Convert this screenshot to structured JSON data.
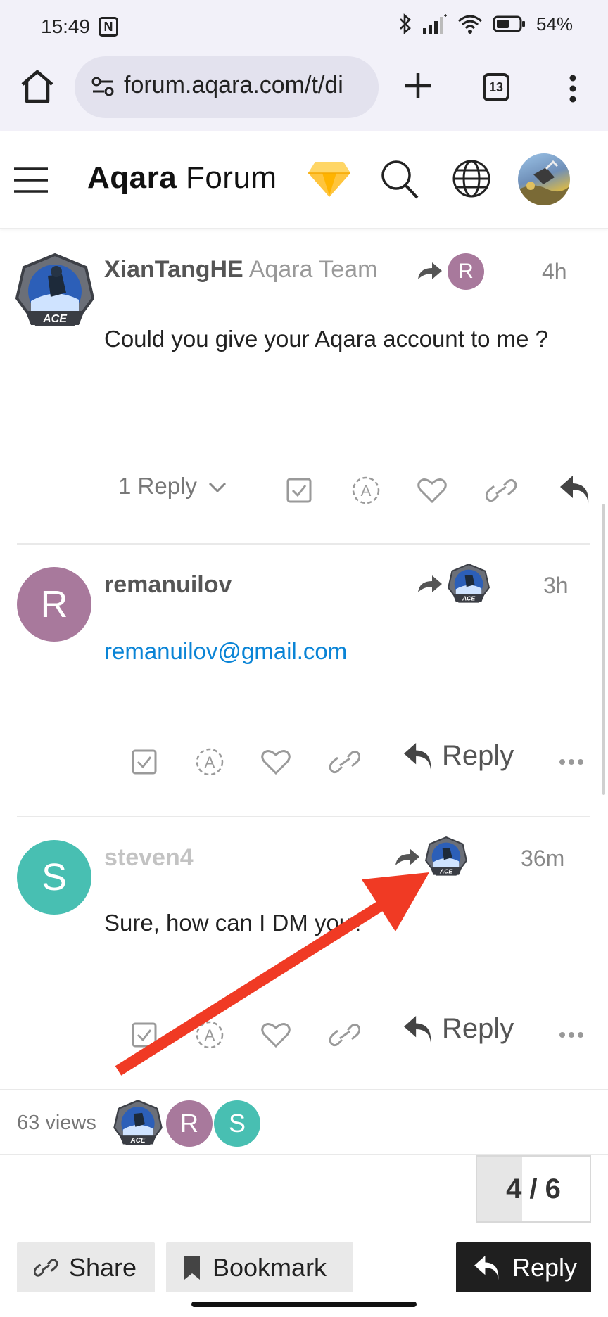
{
  "status_bar": {
    "time": "15:49",
    "nfc": "N",
    "battery_pct": "54%"
  },
  "browser": {
    "url": "forum.aqara.com/t/di",
    "tab_count": "13",
    "icons": [
      "home-icon",
      "site-settings-icon",
      "new-tab-icon",
      "tab-switcher-icon",
      "menu-kebab-icon"
    ]
  },
  "forum_header": {
    "brand": "Aqara",
    "brand_suffix": "Forum",
    "icons": [
      "hamburger-menu-icon",
      "diamond-badge-icon",
      "search-icon",
      "globe-icon",
      "user-avatar"
    ]
  },
  "posts": [
    {
      "author": "XianTangHE",
      "title": "Aqara Team",
      "avatar_badge": "ACE",
      "reply_to_letter": "R",
      "time": "4h",
      "body": "Could you give your Aqara account to me ?",
      "replies_label": "1 Reply"
    },
    {
      "author": "remanuilov",
      "avatar_letter": "R",
      "reply_to_badge": "ACE",
      "time": "3h",
      "body": "remanuilov@gmail.com",
      "reply_label": "Reply"
    },
    {
      "author": "steven4",
      "avatar_letter": "S",
      "reply_to_badge": "ACE",
      "time": "36m",
      "body": "Sure, how can I DM you?",
      "reply_label": "Reply"
    }
  ],
  "footer": {
    "views": "63 views",
    "participants": [
      "ACE",
      "R",
      "S"
    ],
    "progress_label": "4 / 6",
    "progress_current": 4,
    "progress_total": 6,
    "share_label": "Share",
    "bookmark_label": "Bookmark",
    "reply_label": "Reply"
  },
  "colors": {
    "avatar_r": "#a8799c",
    "avatar_s": "#48bfb2",
    "link": "#0a84d6",
    "annotation_arrow": "#f03a24",
    "primary_button": "#1f1f1f"
  }
}
